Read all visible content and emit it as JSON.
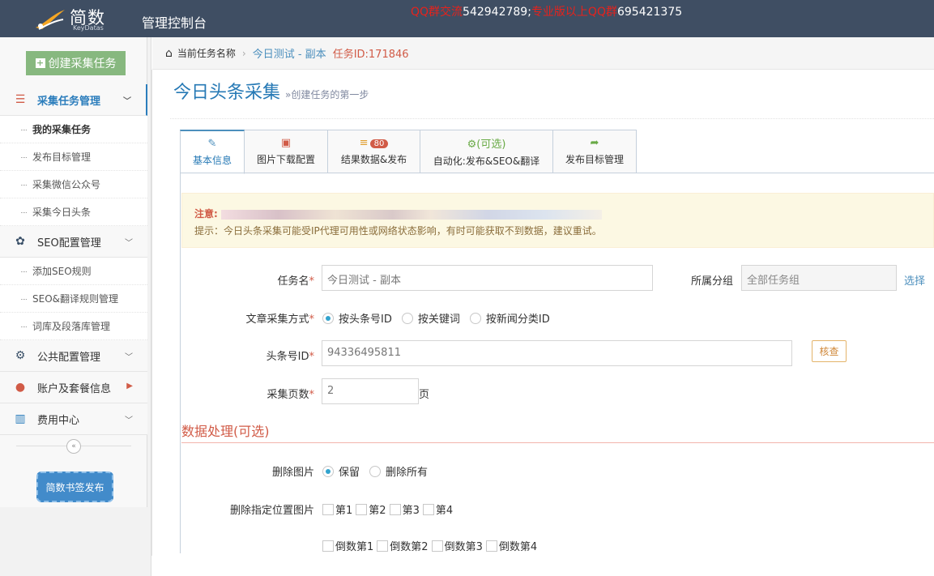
{
  "header": {
    "logo_text": "简数",
    "logo_sub": "KeyDatas",
    "app_title": "管理控制台",
    "notice": {
      "qq_group_label": "QQ群交流",
      "qq_group_no": "542942789;",
      "vip_label": "专业版以上QQ群",
      "vip_no": "695421375"
    }
  },
  "sidebar": {
    "create_button": "创建采集任务",
    "groups": [
      {
        "label": "采集任务管理",
        "icon": "list-icon",
        "items": [
          "我的采集任务",
          "发布目标管理",
          "采集微信公众号",
          "采集今日头条"
        ]
      },
      {
        "label": "SEO配置管理",
        "icon": "gear-icon",
        "items": [
          "添加SEO规则",
          "SEO&翻译规则管理",
          "词库及段落库管理"
        ]
      },
      {
        "label": "公共配置管理",
        "icon": "gears-icon",
        "items": []
      },
      {
        "label": "账户及套餐信息",
        "icon": "user-icon",
        "items": []
      },
      {
        "label": "费用中心",
        "icon": "bar-chart-icon",
        "items": []
      }
    ],
    "bookmark_button": "简数书签发布"
  },
  "breadcrumb": {
    "root": "当前任务名称",
    "current": "今日测试 - 副本",
    "task_id": "任务ID:171846"
  },
  "page": {
    "title": "今日头条采集",
    "subtitle": "»创建任务的第一步"
  },
  "tabs": [
    {
      "label": "基本信息",
      "icon": "edit-icon",
      "top": ""
    },
    {
      "label": "图片下载配置",
      "icon": "image-icon",
      "top": ""
    },
    {
      "label": "结果数据&发布",
      "icon": "database-icon",
      "top": "",
      "badge": "80"
    },
    {
      "label": "自动化:发布&SEO&翻译",
      "icon": "gears-icon",
      "top": "(可选)"
    },
    {
      "label": "发布目标管理",
      "icon": "share-icon",
      "top": ""
    }
  ],
  "alert": {
    "label": "注意:",
    "hint": "提示：今日头条采集可能受IP代理可用性或网络状态影响，有时可能获取不到数据，建议重试。"
  },
  "form": {
    "task_name_label": "任务名",
    "task_name_value": "今日测试 - 副本",
    "group_label": "所属分组",
    "group_value": "全部任务组",
    "group_select": "选择",
    "method_label": "文章采集方式",
    "methods": [
      "按头条号ID",
      "按关键词",
      "按新闻分类ID"
    ],
    "toutiao_id_label": "头条号ID",
    "toutiao_id_value": "94336495811",
    "check_button": "核查",
    "pages_label": "采集页数",
    "pages_value": "2",
    "pages_unit": "页"
  },
  "data_processing": {
    "title": "数据处理(可选)",
    "delete_images_label": "删除图片",
    "delete_images_options": [
      "保留",
      "删除所有"
    ],
    "delete_pos_label": "删除指定位置图片",
    "positions": [
      "第1",
      "第2",
      "第3",
      "第4"
    ],
    "positions_reverse": [
      "倒数第1",
      "倒数第2",
      "倒数第3",
      "倒数第4"
    ]
  }
}
